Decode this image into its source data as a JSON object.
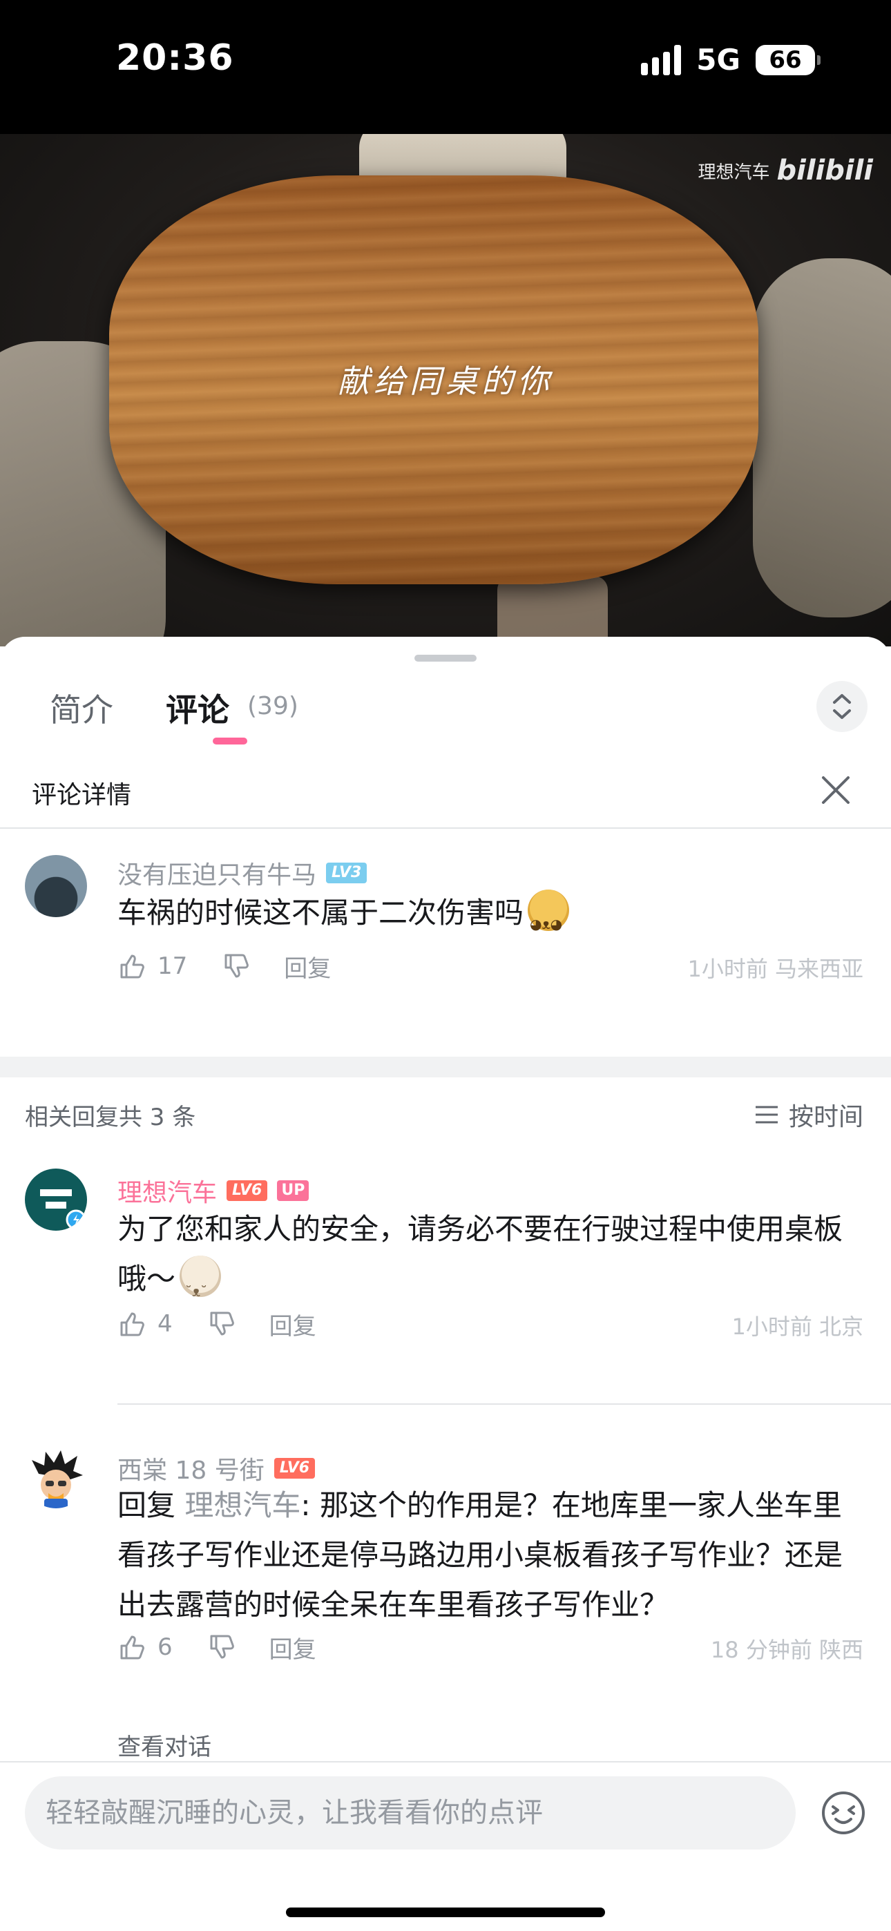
{
  "status_bar": {
    "time": "20:36",
    "network": "5G",
    "battery": "66"
  },
  "video": {
    "caption": "献给同桌的你",
    "watermark_brand": "理想汽车",
    "watermark_site": "bilibili"
  },
  "tabs": [
    {
      "label": "简介"
    },
    {
      "label": "评论",
      "count": "(39)"
    }
  ],
  "detail": {
    "title": "评论详情"
  },
  "root_comment": {
    "username": "没有压迫只有牛马",
    "level": "LV3",
    "text": "车祸的时候这不属于二次伤害吗",
    "likes": "17",
    "reply_label": "回复",
    "meta": "1小时前 马来西亚"
  },
  "replies_header": {
    "count_text": "相关回复共 3 条",
    "sort_label": "按时间"
  },
  "replies": [
    {
      "username": "理想汽车",
      "level": "LV6",
      "badge": "UP",
      "text": "为了您和家人的安全，请务必不要在行驶过程中使用桌板哦～",
      "likes": "4",
      "reply_label": "回复",
      "meta": "1小时前 北京"
    },
    {
      "username": "西棠 18 号街",
      "level": "LV6",
      "reply_prefix": "回复 ",
      "reply_target": "理想汽车",
      "text": ": 那这个的作用是？在地库里一家人坐车里看孩子写作业还是停马路边用小桌板看孩子写作业？还是出去露营的时候全呆在车里看孩子写作业？",
      "likes": "6",
      "reply_label": "回复",
      "meta": "18 分钟前 陕西",
      "view_conversation": "查看对话"
    }
  ],
  "input": {
    "placeholder": "轻轻敲醒沉睡的心灵，让我看看你的点评"
  },
  "colors": {
    "accent": "#fb7299",
    "text": "#18191c",
    "muted": "#9499a0",
    "bg_gray": "#f1f2f3"
  }
}
